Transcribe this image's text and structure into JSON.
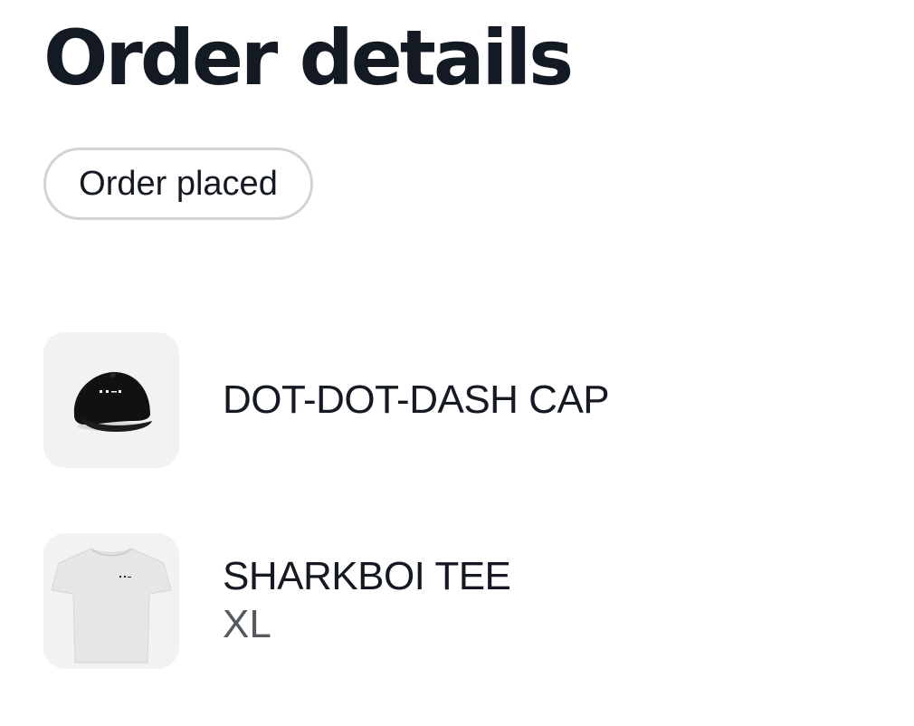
{
  "header": {
    "title": "Order details"
  },
  "status": {
    "label": "Order placed"
  },
  "items": [
    {
      "name": "DOT-DOT-DASH CAP",
      "image_icon": "black-cap-icon"
    },
    {
      "name": "SHARKBOI TEE",
      "variant": "XL",
      "image_icon": "white-tshirt-icon"
    }
  ],
  "colors": {
    "text": "#151a22",
    "muted_text": "#555a60",
    "pill_border": "#d3d3d3",
    "thumb_bg": "#f2f2f2"
  }
}
